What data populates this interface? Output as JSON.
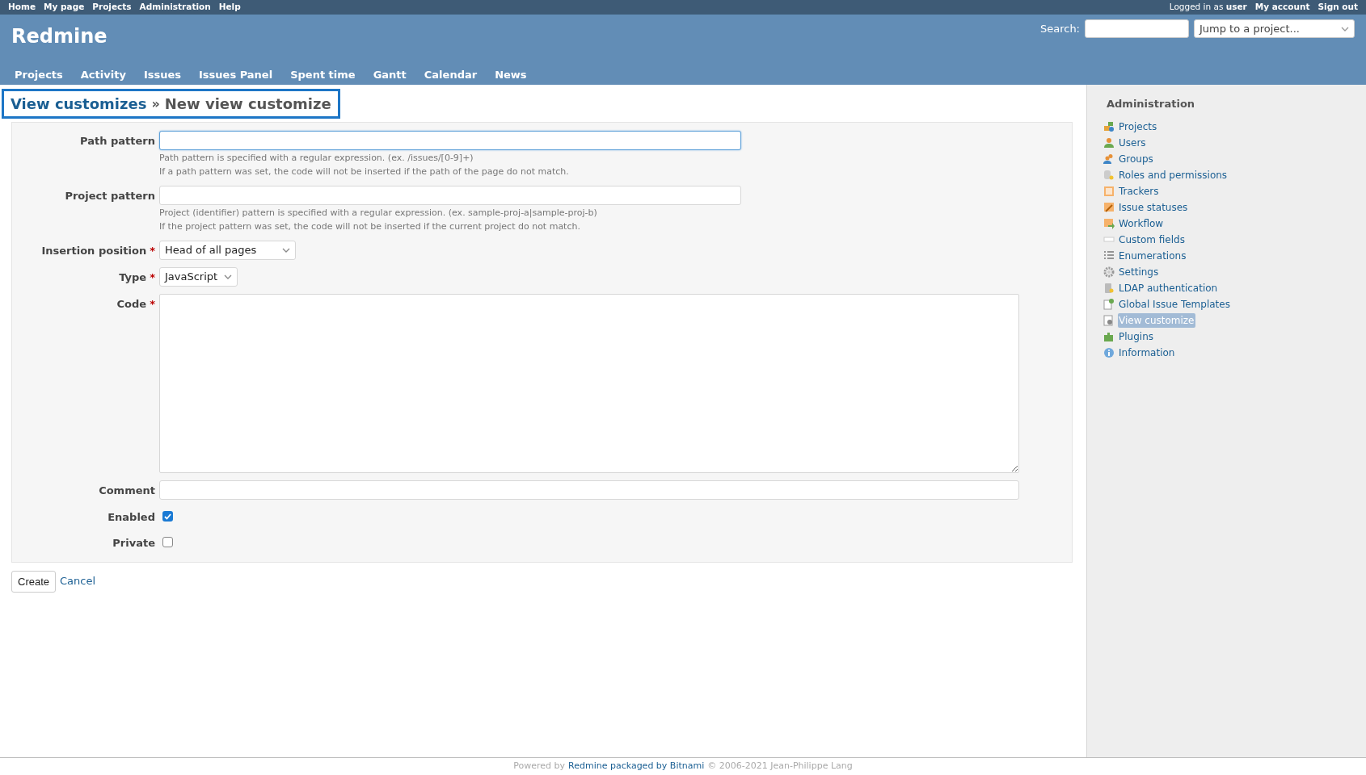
{
  "top_menu": {
    "left": [
      "Home",
      "My page",
      "Projects",
      "Administration",
      "Help"
    ],
    "logged_in_prefix": "Logged in as",
    "logged_in_user": "user",
    "right": [
      "My account",
      "Sign out"
    ]
  },
  "header": {
    "title": "Redmine",
    "search_label": "Search:",
    "project_jump": "Jump to a project..."
  },
  "main_menu": [
    "Projects",
    "Activity",
    "Issues",
    "Issues Panel",
    "Spent time",
    "Gantt",
    "Calendar",
    "News"
  ],
  "page_title": {
    "link": "View customizes",
    "separator": "»",
    "current": "New view customize"
  },
  "form": {
    "fields": [
      {
        "kind": "text",
        "label": "Path pattern",
        "required": false,
        "focused": true,
        "hints": [
          "Path pattern is specified with a regular expression. (ex. /issues/[0-9]+)",
          "If a path pattern was set, the code will not be inserted if the path of the page do not match."
        ]
      },
      {
        "kind": "text",
        "label": "Project pattern",
        "required": false,
        "focused": false,
        "hints": [
          "Project (identifier) pattern is specified with a regular expression. (ex. sample-proj-a|sample-proj-b)",
          "If the project pattern was set, the code will not be inserted if the current project do not match."
        ]
      },
      {
        "kind": "select",
        "label": "Insertion position",
        "required": true,
        "value": "Head of all pages"
      },
      {
        "kind": "select",
        "label": "Type",
        "required": true,
        "value": "JavaScript"
      },
      {
        "kind": "textarea",
        "label": "Code",
        "required": true
      },
      {
        "kind": "wide",
        "label": "Comment",
        "required": false
      },
      {
        "kind": "checkbox",
        "label": "Enabled",
        "required": false,
        "checked": true
      },
      {
        "kind": "checkbox",
        "label": "Private",
        "required": false,
        "checked": false
      }
    ],
    "required_mark": "*"
  },
  "buttons": {
    "submit": "Create",
    "cancel": "Cancel"
  },
  "sidebar": {
    "title": "Administration",
    "items": [
      {
        "label": "Projects",
        "selected": false
      },
      {
        "label": "Users",
        "selected": false
      },
      {
        "label": "Groups",
        "selected": false
      },
      {
        "label": "Roles and permissions",
        "selected": false
      },
      {
        "label": "Trackers",
        "selected": false
      },
      {
        "label": "Issue statuses",
        "selected": false
      },
      {
        "label": "Workflow",
        "selected": false
      },
      {
        "label": "Custom fields",
        "selected": false
      },
      {
        "label": "Enumerations",
        "selected": false
      },
      {
        "label": "Settings",
        "selected": false
      },
      {
        "label": "LDAP authentication",
        "selected": false
      },
      {
        "label": "Global Issue Templates",
        "selected": false
      },
      {
        "label": "View customize",
        "selected": true
      },
      {
        "label": "Plugins",
        "selected": false
      },
      {
        "label": "Information",
        "selected": false
      }
    ]
  },
  "footer": {
    "prefix": "Powered by",
    "link": "Redmine packaged by Bitnami",
    "suffix": "© 2006-2021 Jean-Philippe Lang"
  }
}
